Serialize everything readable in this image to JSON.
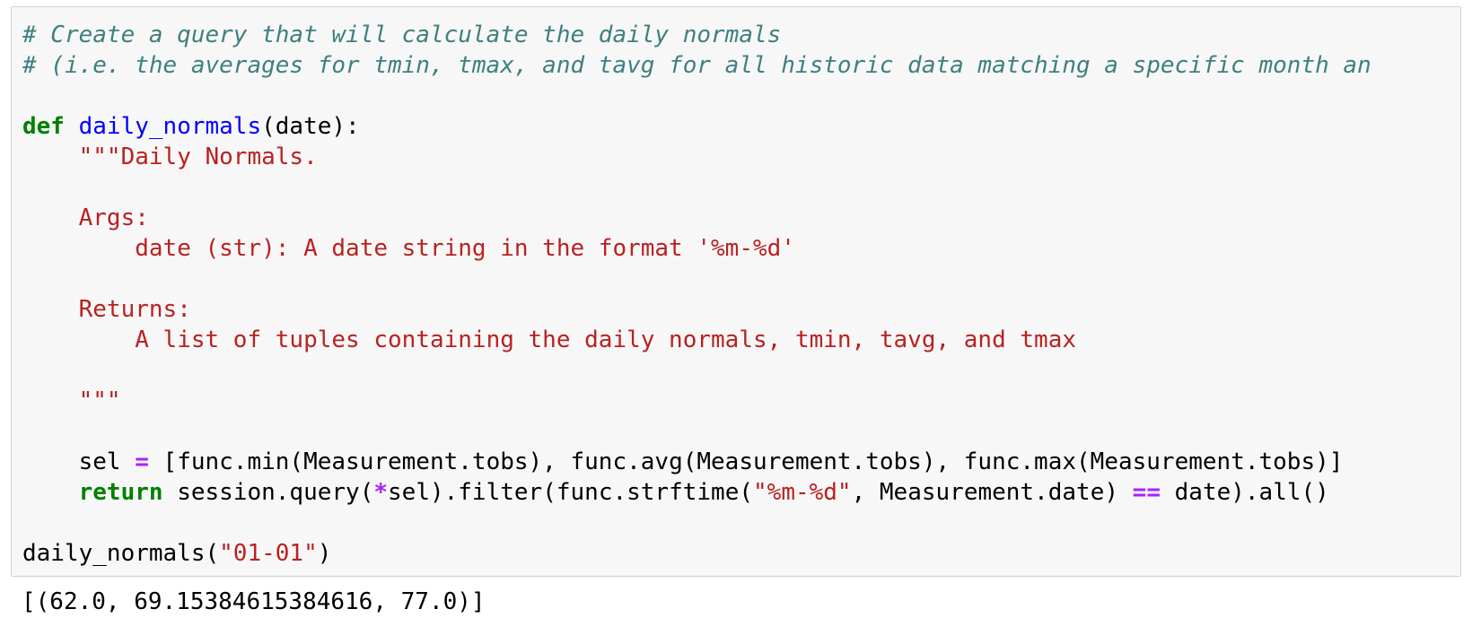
{
  "input_cell": {
    "lines": [
      [
        {
          "t": "comment",
          "v": "# Create a query that will calculate the daily normals"
        }
      ],
      [
        {
          "t": "comment",
          "v": "# (i.e. the averages for tmin, tmax, and tavg for all historic data matching a specific month an"
        }
      ],
      [],
      [
        {
          "t": "kw",
          "v": "def"
        },
        {
          "t": "plain",
          "v": " "
        },
        {
          "t": "fn",
          "v": "daily_normals"
        },
        {
          "t": "plain",
          "v": "(date):"
        }
      ],
      [
        {
          "t": "plain",
          "v": "    "
        },
        {
          "t": "str",
          "v": "\"\"\"Daily Normals."
        }
      ],
      [],
      [
        {
          "t": "plain",
          "v": "    "
        },
        {
          "t": "str",
          "v": "Args:"
        }
      ],
      [
        {
          "t": "plain",
          "v": "        "
        },
        {
          "t": "str",
          "v": "date (str): A date string in the format '%m-%d'"
        }
      ],
      [],
      [
        {
          "t": "plain",
          "v": "    "
        },
        {
          "t": "str",
          "v": "Returns:"
        }
      ],
      [
        {
          "t": "plain",
          "v": "        "
        },
        {
          "t": "str",
          "v": "A list of tuples containing the daily normals, tmin, tavg, and tmax"
        }
      ],
      [],
      [
        {
          "t": "plain",
          "v": "    "
        },
        {
          "t": "str",
          "v": "\"\"\""
        }
      ],
      [],
      [
        {
          "t": "plain",
          "v": "    sel "
        },
        {
          "t": "op",
          "v": "="
        },
        {
          "t": "plain",
          "v": " [func.min(Measurement.tobs), func.avg(Measurement.tobs), func.max(Measurement.tobs)]"
        }
      ],
      [
        {
          "t": "plain",
          "v": "    "
        },
        {
          "t": "kw",
          "v": "return"
        },
        {
          "t": "plain",
          "v": " session.query("
        },
        {
          "t": "op",
          "v": "*"
        },
        {
          "t": "plain",
          "v": "sel).filter(func.strftime("
        },
        {
          "t": "str",
          "v": "\"%m-%d\""
        },
        {
          "t": "plain",
          "v": ", Measurement.date) "
        },
        {
          "t": "op",
          "v": "=="
        },
        {
          "t": "plain",
          "v": " date).all()"
        }
      ],
      [],
      [
        {
          "t": "plain",
          "v": "daily_normals("
        },
        {
          "t": "str",
          "v": "\"01-01\""
        },
        {
          "t": "plain",
          "v": ")"
        }
      ]
    ]
  },
  "output_cell": {
    "text": "[(62.0, 69.15384615384616, 77.0)]"
  },
  "colors": {
    "comment": "#408080",
    "keyword": "#008000",
    "function": "#0000ff",
    "string": "#ba2121",
    "operator": "#aa22ff",
    "cell_background": "#f7f7f7",
    "cell_border": "#cfcfcf"
  }
}
